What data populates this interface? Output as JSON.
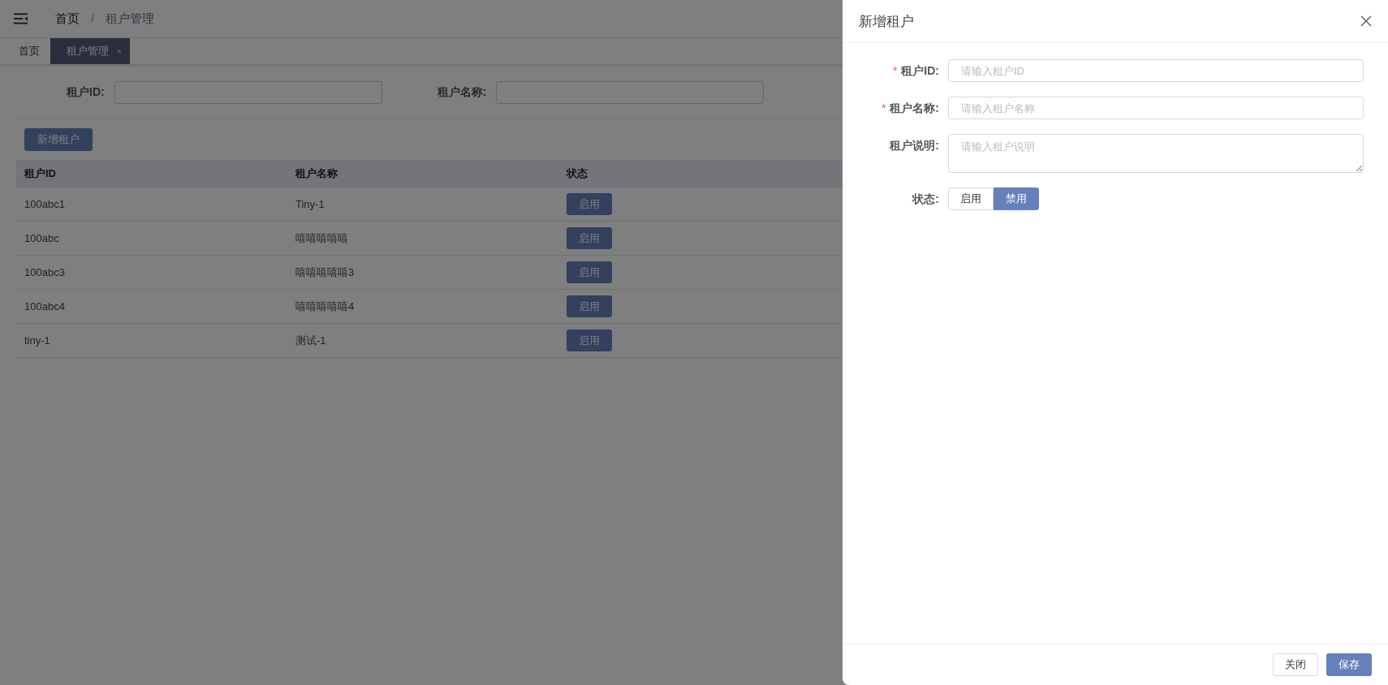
{
  "breadcrumb": {
    "items": [
      "首页",
      "租户管理"
    ],
    "separator": "/"
  },
  "tabs": [
    {
      "label": "首页",
      "selected": false
    },
    {
      "label": "租户管理",
      "selected": true,
      "close": "×"
    }
  ],
  "filters": [
    {
      "label": "租户ID:"
    },
    {
      "label": "租户名称:"
    }
  ],
  "add_button": "新增租户",
  "table": {
    "columns": [
      "租户ID",
      "租户名称",
      "状态"
    ],
    "rows": [
      [
        "100abc1",
        "Tiny-1",
        "启用"
      ],
      [
        "100abc",
        "嘻嘻嘻嘻嘻",
        "启用"
      ],
      [
        "100abc3",
        "嘻嘻嘻嘻嘻3",
        "启用"
      ],
      [
        "100abc4",
        "嘻嘻嘻嘻嘻4",
        "启用"
      ],
      [
        "tiny-1",
        "测试-1",
        "启用"
      ]
    ]
  },
  "drawer": {
    "title": "新增租户",
    "fields": [
      {
        "kind": "input",
        "label": "租户ID:",
        "required_mark": "*",
        "placeholder": "请输入租户ID"
      },
      {
        "kind": "input",
        "label": "租户名称:",
        "required_mark": "*",
        "placeholder": "请输入租户名称"
      },
      {
        "kind": "textarea",
        "label": "租户说明:",
        "placeholder": "请输入租户说明"
      },
      {
        "kind": "toggle",
        "label": "状态:",
        "options": [
          {
            "label": "启用",
            "selected": false
          },
          {
            "label": "禁用",
            "selected": true
          }
        ]
      }
    ],
    "buttons": [
      {
        "label": "关闭",
        "primary": false
      },
      {
        "label": "保存",
        "primary": true
      }
    ]
  }
}
